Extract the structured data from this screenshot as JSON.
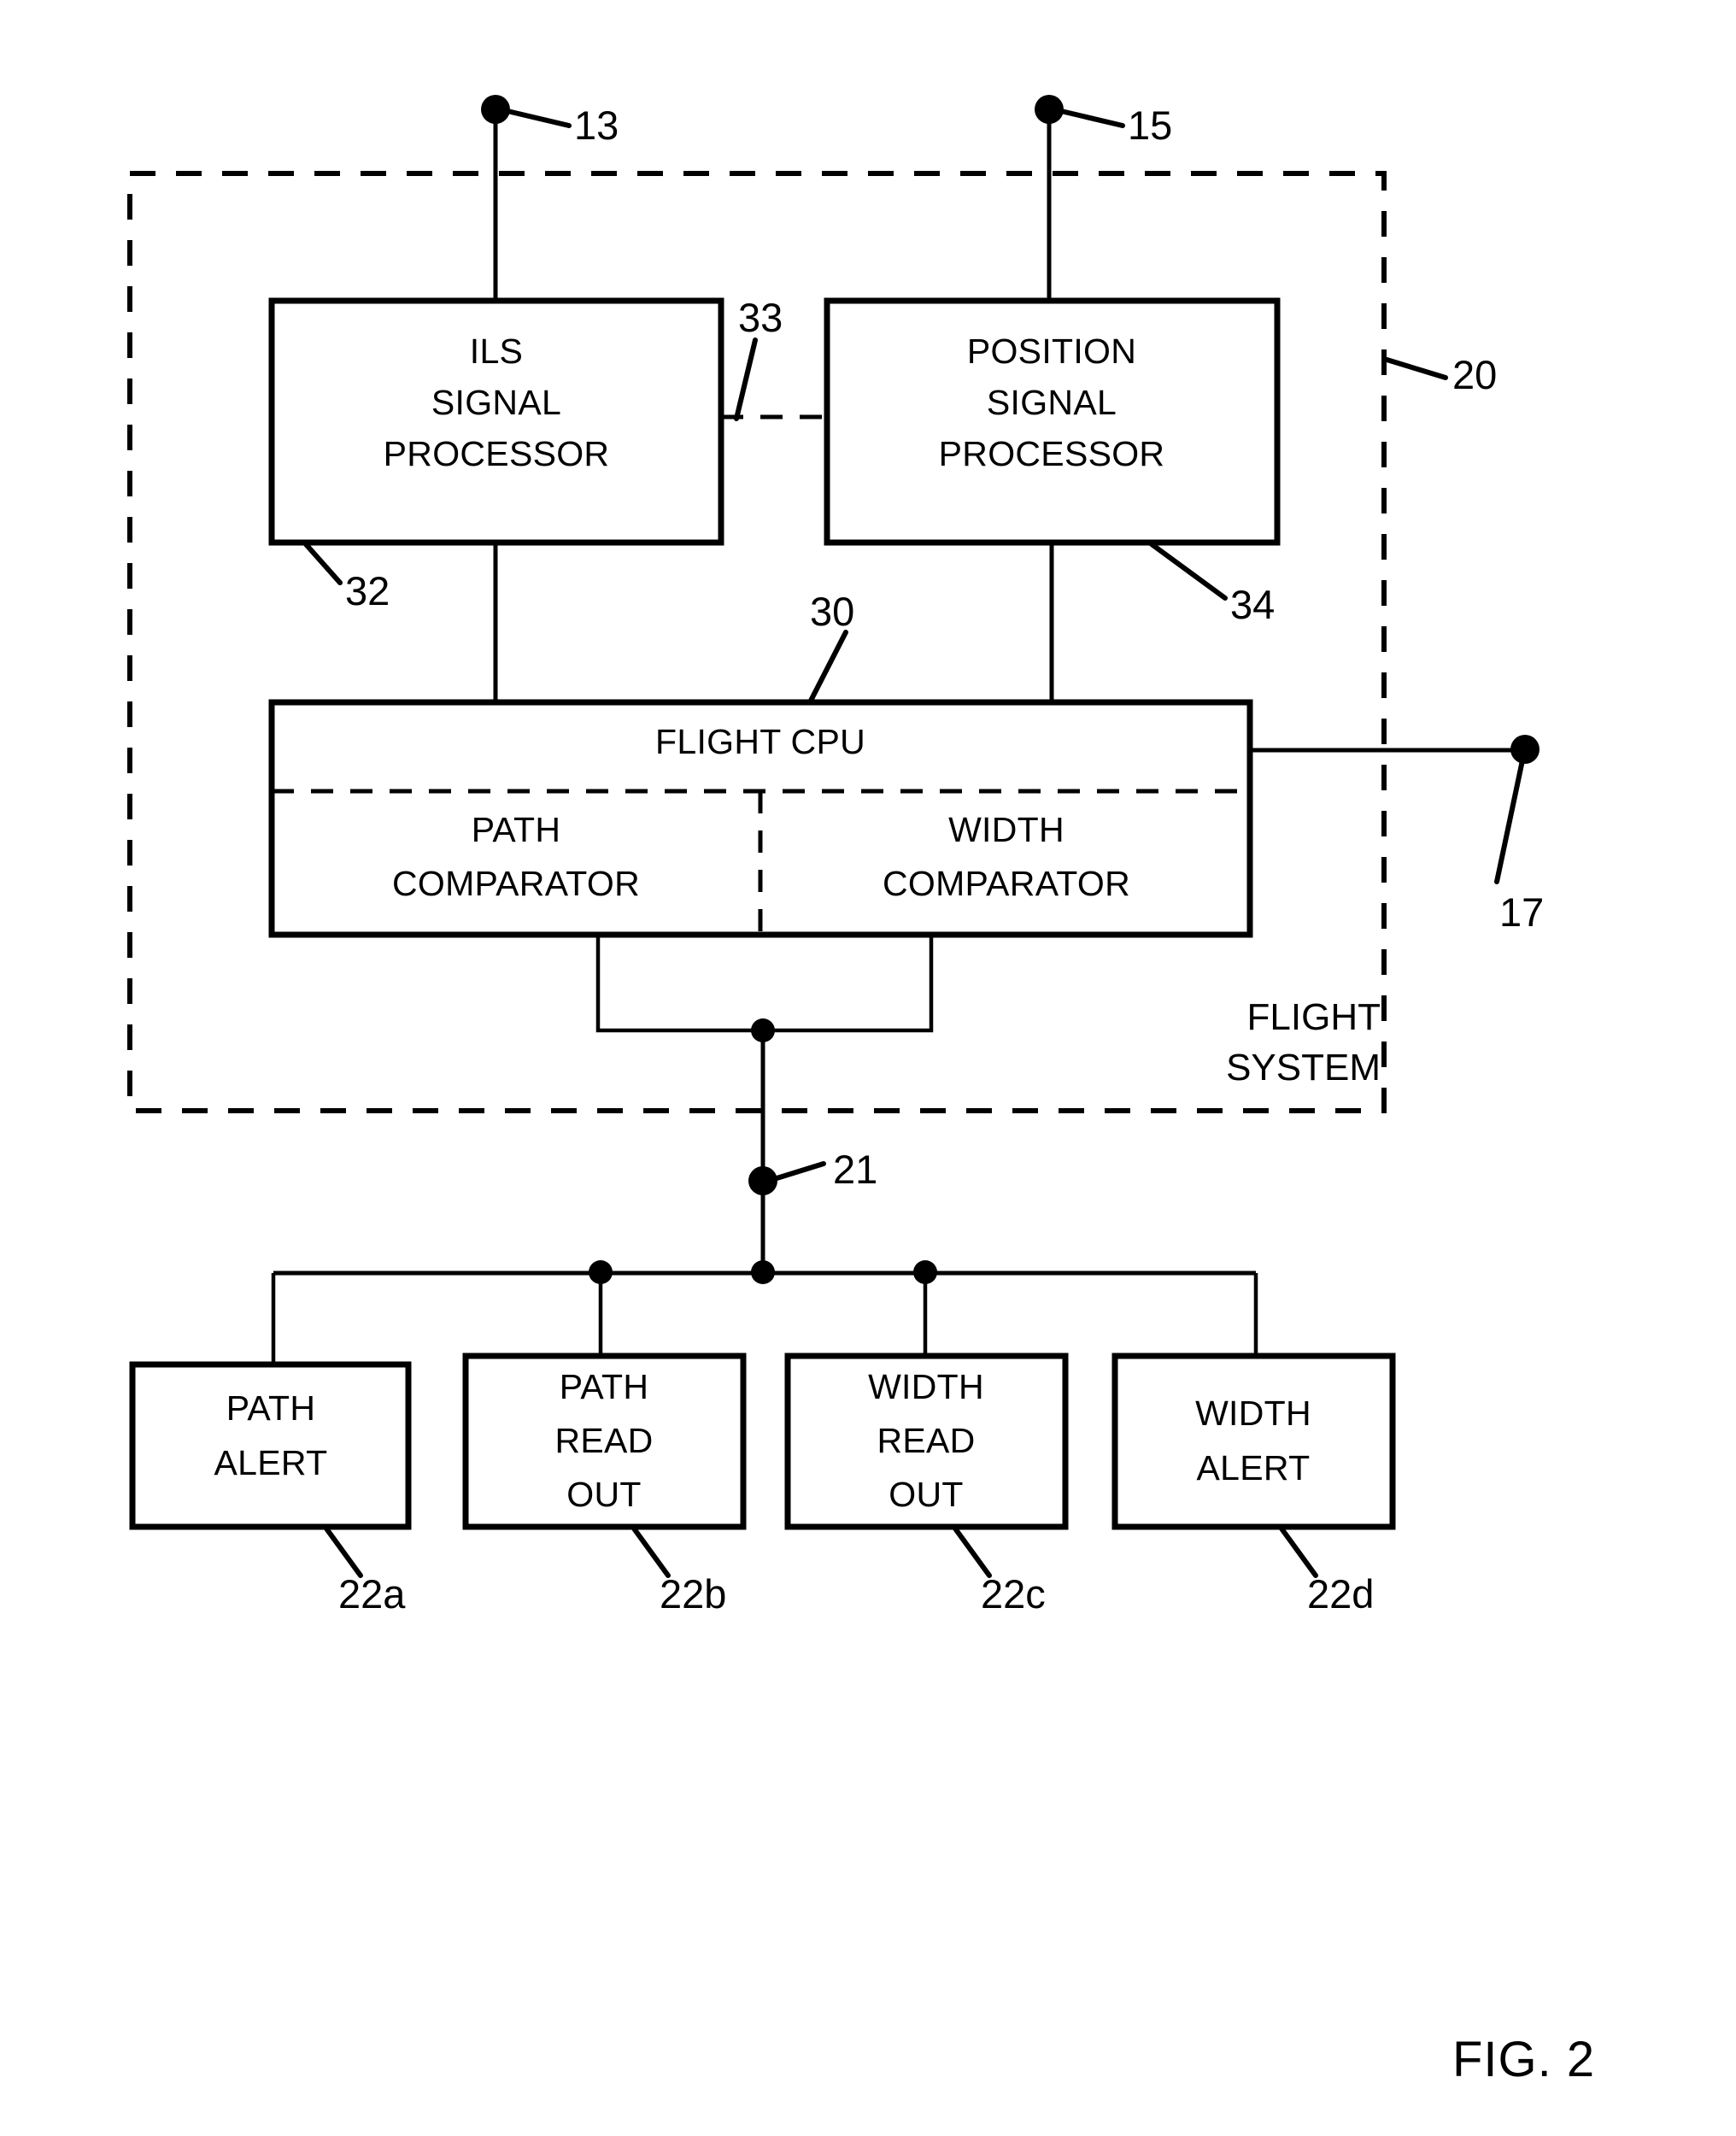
{
  "figure": {
    "caption": "FIG. 2",
    "system_label_line1": "FLIGHT",
    "system_label_line2": "SYSTEM",
    "system_boundary_ref": "20"
  },
  "terminals": [
    {
      "id": "ils-input",
      "ref": "13"
    },
    {
      "id": "position-input",
      "ref": "15"
    },
    {
      "id": "cpu-output",
      "ref": "17"
    },
    {
      "id": "output-bus",
      "ref": "21"
    }
  ],
  "blocks": {
    "ils_signal_processor": {
      "ref": "32",
      "lines": [
        "ILS",
        "SIGNAL",
        "PROCESSOR"
      ]
    },
    "position_signal_processor": {
      "ref": "34",
      "lines": [
        "POSITION",
        "SIGNAL",
        "PROCESSOR"
      ]
    },
    "flight_cpu": {
      "ref": "30",
      "title": "FLIGHT CPU",
      "path_comparator": {
        "lines": [
          "PATH",
          "COMPARATOR"
        ]
      },
      "width_comparator": {
        "lines": [
          "WIDTH",
          "COMPARATOR"
        ]
      }
    },
    "interconnect": {
      "ref": "33"
    },
    "outputs": [
      {
        "ref": "22a",
        "lines": [
          "PATH",
          "ALERT"
        ]
      },
      {
        "ref": "22b",
        "lines": [
          "PATH",
          "READ",
          "OUT"
        ]
      },
      {
        "ref": "22c",
        "lines": [
          "WIDTH",
          "READ",
          "OUT"
        ]
      },
      {
        "ref": "22d",
        "lines": [
          "WIDTH",
          "ALERT"
        ]
      }
    ]
  },
  "colors": {
    "ink": "#000000",
    "paper": "#ffffff"
  }
}
